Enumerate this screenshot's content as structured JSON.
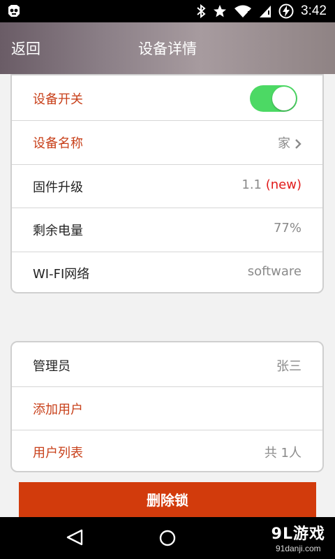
{
  "statusbar": {
    "time": "3:42"
  },
  "header": {
    "back": "返回",
    "title": "设备详情"
  },
  "device_card": {
    "switch_label": "设备开关",
    "switch_on": true,
    "name_label": "设备名称",
    "name_value": "家",
    "firmware_label": "固件升级",
    "firmware_version": "1.1",
    "firmware_new": "(new)",
    "battery_label": "剩余电量",
    "battery_value": "77%",
    "wifi_label": "WI-FI网络",
    "wifi_value": "software"
  },
  "user_card": {
    "admin_label": "管理员",
    "admin_value": "张三",
    "add_user_label": "添加用户",
    "user_list_label": "用户列表",
    "user_list_value": "共 1人"
  },
  "delete_button": "删除锁",
  "watermark": {
    "big": "9L游戏",
    "small": "91danji.com"
  },
  "colors": {
    "accent": "#c8401a",
    "button": "#d23b0c",
    "toggle": "#4cd964"
  }
}
